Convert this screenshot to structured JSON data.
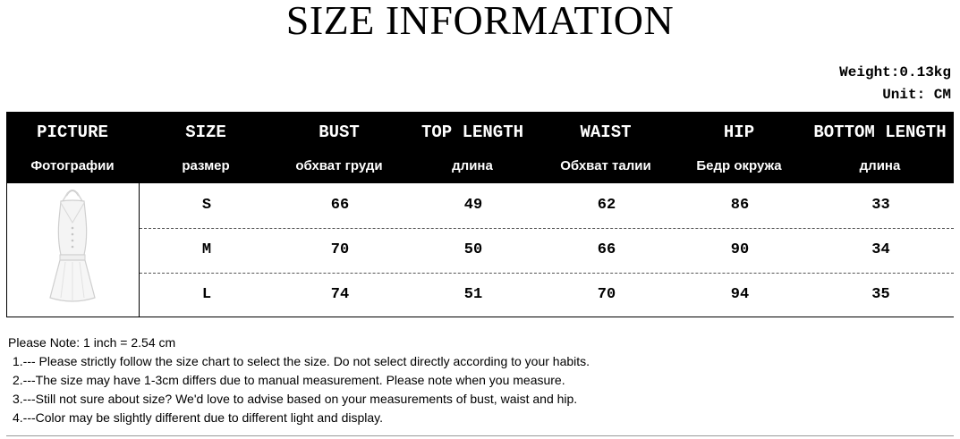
{
  "title": "SIZE INFORMATION",
  "meta": {
    "weight": "Weight:0.13kg",
    "unit": "Unit: CM"
  },
  "table": {
    "headers": [
      {
        "en": "PICTURE",
        "ru": "Фотографии"
      },
      {
        "en": "SIZE",
        "ru": "размер"
      },
      {
        "en": "BUST",
        "ru": "обхват груди"
      },
      {
        "en": "TOP LENGTH",
        "ru": "длина"
      },
      {
        "en": "WAIST",
        "ru": "Обхват талии"
      },
      {
        "en": "HIP",
        "ru": "Бедр окружа"
      },
      {
        "en": "BOTTOM LENGTH",
        "ru": "длина"
      }
    ],
    "rows": [
      {
        "size": "S",
        "bust": "66",
        "top_length": "49",
        "waist": "62",
        "hip": "86",
        "bottom_length": "33"
      },
      {
        "size": "M",
        "bust": "70",
        "top_length": "50",
        "waist": "66",
        "hip": "90",
        "bottom_length": "34"
      },
      {
        "size": "L",
        "bust": "74",
        "top_length": "51",
        "waist": "70",
        "hip": "94",
        "bottom_length": "35"
      }
    ]
  },
  "notes": {
    "intro": "Please Note: 1 inch = 2.54 cm",
    "items": [
      "1.--- Please strictly follow the size chart to select the size. Do not select directly according to your habits.",
      "2.---The size may have 1-3cm differs due to manual measurement. Please note when you measure.",
      "3.---Still not sure about size? We'd love to advise based on your measurements of bust, waist and hip.",
      "4.---Color may be slightly different due to different light and display."
    ]
  }
}
